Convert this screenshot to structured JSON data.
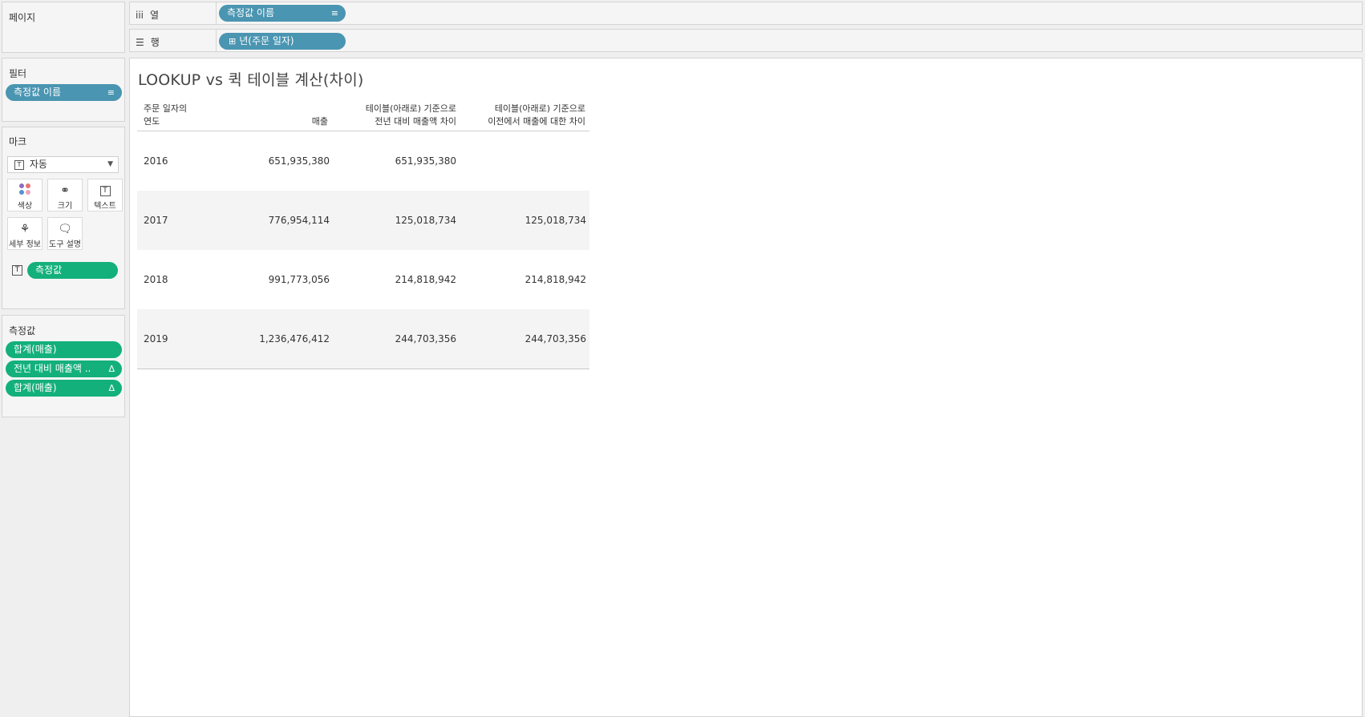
{
  "pages_card": {
    "title": "페이지"
  },
  "columns_shelf": {
    "label": "열",
    "icon": "columns-icon",
    "pill": "측정값 이름",
    "pill_icon": "sort-icon"
  },
  "rows_shelf": {
    "label": "행",
    "icon": "rows-icon",
    "pill": "년(주문 일자)",
    "pill_icon": "expand-icon"
  },
  "filters_card": {
    "title": "필터",
    "pill": "측정값 이름",
    "pill_icon": "sort-icon"
  },
  "marks_card": {
    "title": "마크",
    "mark_type": "자동",
    "buttons": {
      "color": "색상",
      "size": "크기",
      "text": "텍스트",
      "detail": "세부 정보",
      "tooltip": "도구 설명"
    },
    "text_pill": "측정값"
  },
  "measures_card": {
    "title": "측정값",
    "pills": [
      {
        "label": "합계(매출)",
        "icon": ""
      },
      {
        "label": "전년 대비 매출액 ..",
        "icon": "Δ"
      },
      {
        "label": "합계(매출)",
        "icon": "Δ"
      }
    ]
  },
  "viz": {
    "title": "LOOKUP vs 퀵 테이블 계산(차이)",
    "headers": {
      "year_line1": "주문 일자의",
      "year_line2": "연도",
      "sales": "매출",
      "c3_line1": "테이블(아래로) 기준으로",
      "c3_line2": "전년 대비 매출액 차이",
      "c4_line1": "테이블(아래로) 기준으로",
      "c4_line2": "이전에서 매출에 대한 차이"
    },
    "rows": [
      {
        "year": "2016",
        "sales": "651,935,380",
        "c3": "651,935,380",
        "c4": ""
      },
      {
        "year": "2017",
        "sales": "776,954,114",
        "c3": "125,018,734",
        "c4": "125,018,734"
      },
      {
        "year": "2018",
        "sales": "991,773,056",
        "c3": "214,818,942",
        "c4": "214,818,942"
      },
      {
        "year": "2019",
        "sales": "1,236,476,412",
        "c3": "244,703,356",
        "c4": "244,703,356"
      }
    ]
  },
  "colors": {
    "dimension_pill": "#4a95b1",
    "measure_pill": "#13b07c"
  }
}
